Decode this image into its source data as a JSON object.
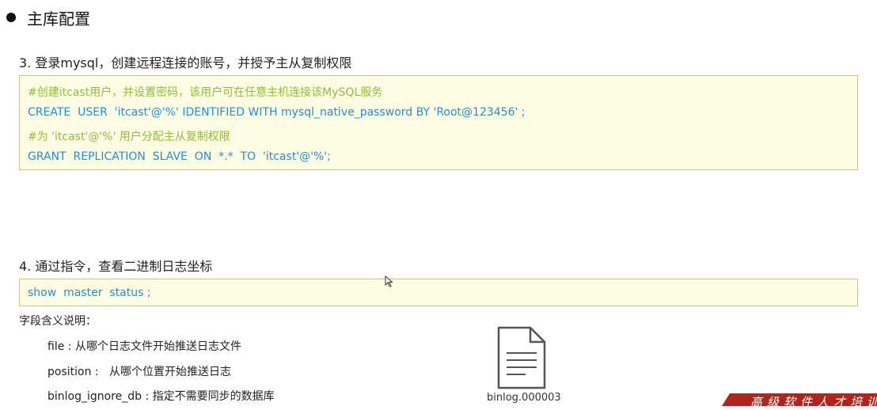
{
  "heading": "主库配置",
  "step3": {
    "title": "3. 登录mysql，创建远程连接的账号，并授予主从复制权限",
    "lines": [
      "#创建itcast用户，并设置密码，该用户可在任意主机连接该MySQL服务",
      "CREATE  USER  'itcast'@'%' IDENTIFIED WITH mysql_native_password BY 'Root@123456' ;",
      "#为 'itcast'@'%' 用户分配主从复制权限",
      "GRANT  REPLICATION  SLAVE  ON  *.*  TO  'itcast'@'%';"
    ]
  },
  "step4": {
    "title": "4. 通过指令，查看二进制日志坐标",
    "command": "show  master  status ;"
  },
  "fields": {
    "title": "字段含义说明：",
    "items": [
      "file : 从哪个日志文件开始推送日志文件",
      "position :   从哪个位置开始推送日志",
      "binlog_ignore_db : 指定不需要同步的数据库"
    ]
  },
  "file_icon": {
    "label": "binlog.000003"
  },
  "banner": {
    "text": "高级软件人才培训"
  },
  "colors": {
    "comment": "#8fbe3c",
    "sql": "#2a8bd1",
    "box_bg": "#fdfde4",
    "box_border": "#c5c58a",
    "banner": "#b0241b"
  }
}
